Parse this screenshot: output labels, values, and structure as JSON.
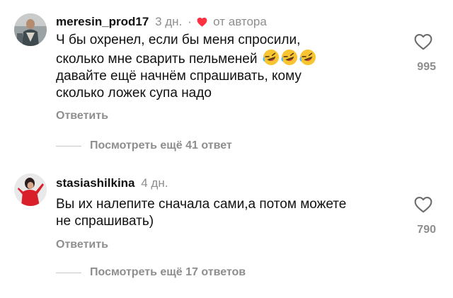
{
  "comments": [
    {
      "username": "meresin_prod17",
      "time": "3 дн.",
      "separator": "·",
      "author_badge": "от автора",
      "text_lines": [
        "Ч бы охренел, если бы меня спросили,",
        "сколько мне сварить пельменей",
        "давайте ещё начнём спрашивать, кому",
        "сколько ложек супа надо"
      ],
      "emoji": [
        "rofl-emoji",
        "rofl-emoji",
        "rofl-emoji"
      ],
      "reply_label": "Ответить",
      "likes": "995",
      "view_more_label": "Посмотреть ещё 41 ответ"
    },
    {
      "username": "stasiashilkina",
      "time": "4 дн.",
      "text_lines": [
        "Вы их налепите сначала сами,а потом можете",
        "не спрашивать)"
      ],
      "reply_label": "Ответить",
      "likes": "790",
      "view_more_label": "Посмотреть ещё 17 ответов"
    }
  ],
  "colors": {
    "text": "#111111",
    "secondary": "#8e8e8e",
    "author_heart": "#ff3040",
    "divider": "#c7c7c7"
  }
}
